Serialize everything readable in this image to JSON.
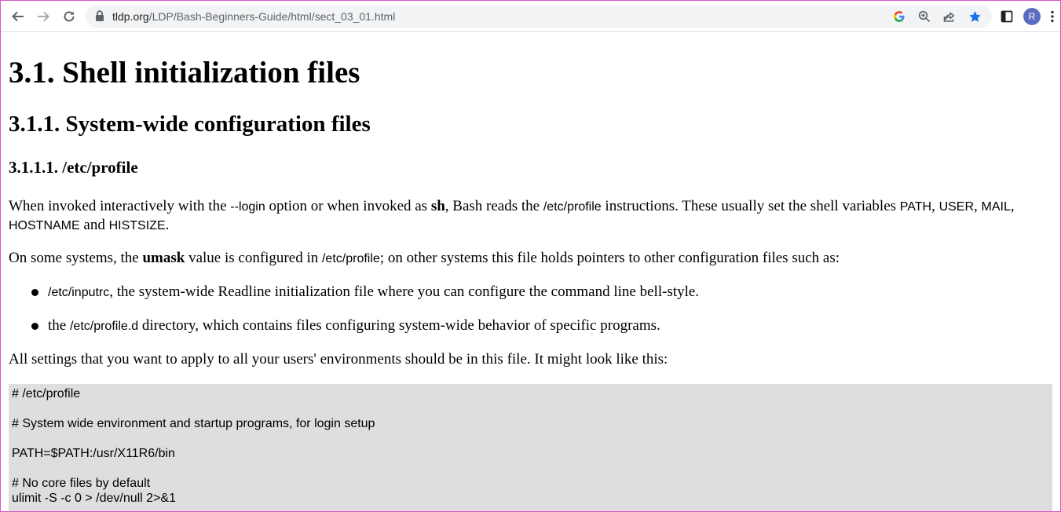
{
  "browser": {
    "url_host": "tldp.org",
    "url_path": "/LDP/Bash-Beginners-Guide/html/sect_03_01.html",
    "profile_initial": "R",
    "accent_color": "#1a73e8"
  },
  "page": {
    "title": "3.1. Shell initialization files",
    "section_title": "3.1.1. System-wide configuration files",
    "subsection_title": "3.1.1.1. /etc/profile",
    "p1": {
      "t1": "When invoked interactively with the ",
      "c1": "--login",
      "t2": " option or when invoked as ",
      "b1": "sh",
      "t3": ", Bash reads the ",
      "c2": "/etc/profile",
      "t4": " instructions. These usually set the shell variables ",
      "c3": "PATH",
      "t5": ", ",
      "c4": "USER",
      "t6": ", ",
      "c5": "MAIL",
      "t7": ", ",
      "c6": "HOSTNAME",
      "t8": " and ",
      "c7": "HISTSIZE",
      "t9": "."
    },
    "p2": {
      "t1": "On some systems, the ",
      "b1": "umask",
      "t2": " value is configured in ",
      "c1": "/etc/profile",
      "t3": "; on other systems this file holds pointers to other configuration files such as:"
    },
    "list": [
      {
        "pre": "",
        "code": "/etc/inputrc",
        "post": ", the system-wide Readline initialization file where you can configure the command line bell-style."
      },
      {
        "pre": "the ",
        "code": "/etc/profile.d",
        "post": " directory, which contains files configuring system-wide behavior of specific programs."
      }
    ],
    "p3": "All settings that you want to apply to all your users' environments should be in this file. It might look like this:",
    "code_block": {
      "line1": "# /etc/profile",
      "line2": "# System wide environment and startup programs, for login setup",
      "line3": "PATH=$PATH:/usr/X11R6/bin",
      "line4": "# No core files by default",
      "line5": "ulimit -S -c 0 > /dev/null 2>&1"
    }
  }
}
